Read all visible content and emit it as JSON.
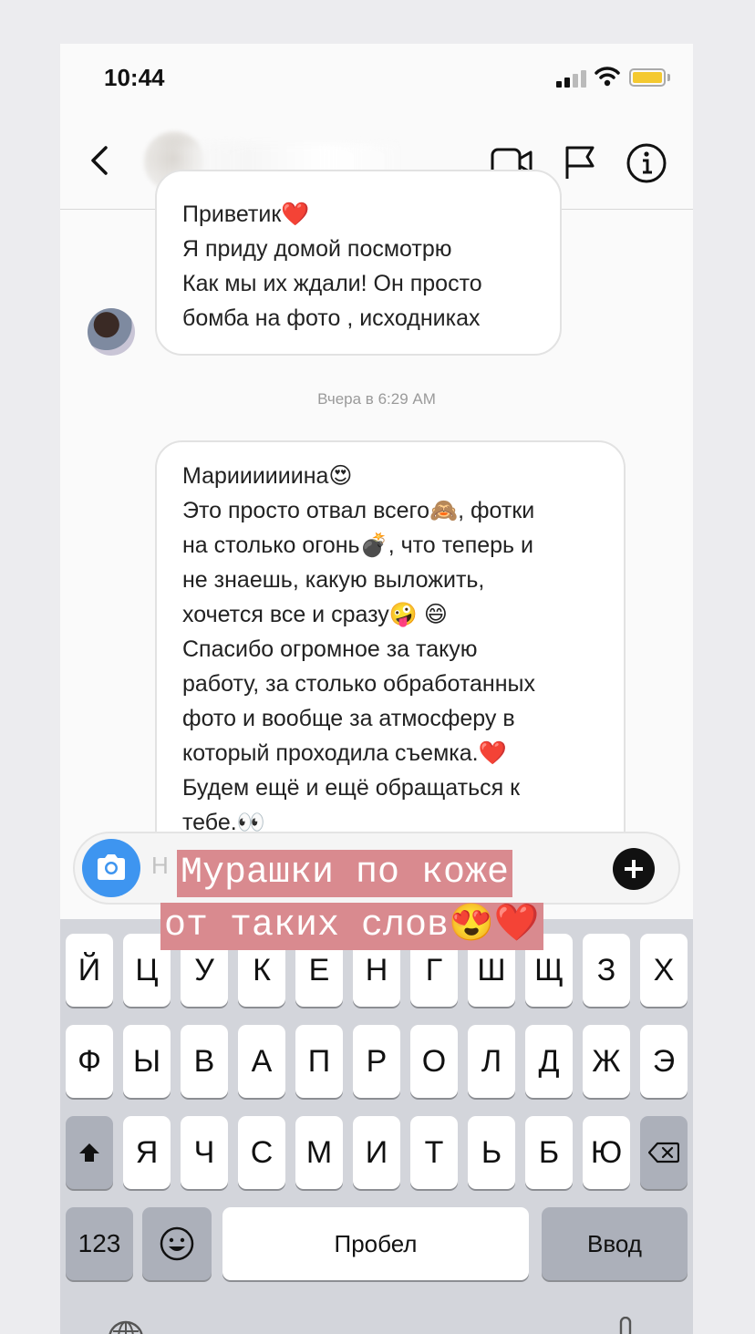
{
  "status_bar": {
    "time": "10:44"
  },
  "chat": {
    "message1_lines": [
      "Приветик❤️",
      "Я приду домой посмотрю",
      "Как мы их ждали! Он просто",
      "бомба на фото , исходниках"
    ],
    "timestamp": "Вчера в 6:29 AM",
    "message2_lines": [
      "Мариииииина😍",
      "Это просто отвал всего🙈, фотки",
      "на столько огонь💣, что теперь и",
      "не знаешь, какую выложить,",
      "хочется все и сразу🤪 😄",
      "Спасибо огромное за такую",
      "работу, за столько обработанных",
      "фото и вообще за атмосферу в",
      "который проходила съемка.❤️",
      "Будем ещё и ещё обращаться к",
      "тебе.👀"
    ]
  },
  "composer": {
    "placeholder": "Н"
  },
  "story_caption": {
    "line1": "Мурашки по коже",
    "line2": "от таких слов😍❤️"
  },
  "keyboard": {
    "row1": [
      "Й",
      "Ц",
      "У",
      "К",
      "Е",
      "Н",
      "Г",
      "Ш",
      "Щ",
      "З",
      "Х"
    ],
    "row2": [
      "Ф",
      "Ы",
      "В",
      "А",
      "П",
      "Р",
      "О",
      "Л",
      "Д",
      "Ж",
      "Э"
    ],
    "row3": [
      "Я",
      "Ч",
      "С",
      "М",
      "И",
      "Т",
      "Ь",
      "Б",
      "Ю"
    ],
    "numbers_key": "123",
    "space_key": "Пробел",
    "return_key": "Ввод"
  },
  "colors": {
    "accent_blue": "#3e95f0",
    "caption_bg": "#d98a8f",
    "battery": "#f4c930"
  }
}
